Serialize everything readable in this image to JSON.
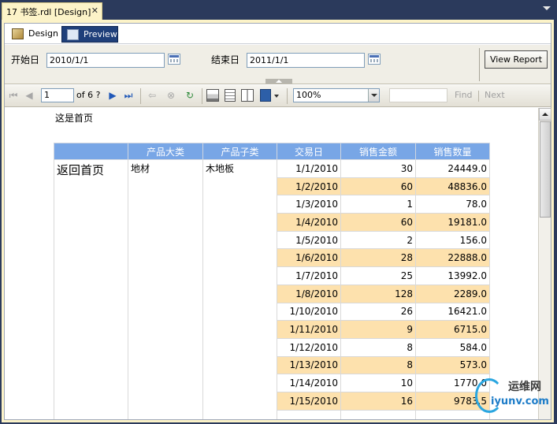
{
  "document_tab": {
    "title": "17 书签.rdl [Design]",
    "close": "✕"
  },
  "view_tabs": {
    "design": "Design",
    "preview": "Preview"
  },
  "parameters": {
    "start_label": "开始日",
    "start_value": "2010/1/1",
    "end_label": "结束日",
    "end_value": "2011/1/1",
    "view_report": "View Report"
  },
  "toolbar": {
    "page": "1",
    "of_pages": "of  6 ?",
    "zoom": "100%",
    "find": "Find",
    "next": "Next"
  },
  "report": {
    "heading": "这是首页",
    "back_link": "返回首页",
    "columns": [
      "",
      "产品大类",
      "产品子类",
      "交易日",
      "销售金额",
      "销售数量"
    ],
    "category": "地材",
    "subcategory": "木地板",
    "rows": [
      [
        "1/1/2010",
        "30",
        "24449.0"
      ],
      [
        "1/2/2010",
        "60",
        "48836.0"
      ],
      [
        "1/3/2010",
        "1",
        "78.0"
      ],
      [
        "1/4/2010",
        "60",
        "19181.0"
      ],
      [
        "1/5/2010",
        "2",
        "156.0"
      ],
      [
        "1/6/2010",
        "28",
        "22888.0"
      ],
      [
        "1/7/2010",
        "25",
        "13992.0"
      ],
      [
        "1/8/2010",
        "128",
        "2289.0"
      ],
      [
        "1/10/2010",
        "26",
        "16421.0"
      ],
      [
        "1/11/2010",
        "9",
        "6715.0"
      ],
      [
        "1/12/2010",
        "8",
        "584.0"
      ],
      [
        "1/13/2010",
        "8",
        "573.0"
      ],
      [
        "1/14/2010",
        "10",
        "1770.0"
      ],
      [
        "1/15/2010",
        "16",
        "9783.5"
      ],
      [
        "",
        "",
        ""
      ]
    ]
  },
  "watermark": {
    "cn": "运维网",
    "en": "iyunv.com"
  },
  "colors": {
    "header": "#78a6e6",
    "alt_row": "#fde1ad",
    "preview_tab": "#1f3f7a"
  }
}
